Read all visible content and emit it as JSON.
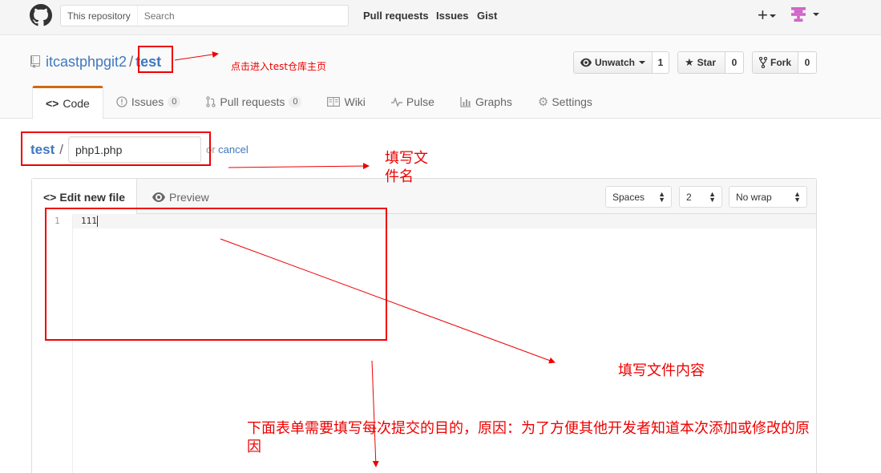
{
  "header": {
    "search_scope": "This repository",
    "search_placeholder": "Search",
    "nav": [
      "Pull requests",
      "Issues",
      "Gist"
    ],
    "plus_icon": "plus-icon",
    "avatar_color": "#d066c8"
  },
  "repo": {
    "owner": "itcastphpgit2",
    "name": "test",
    "separator": "/",
    "unwatch_label": "Unwatch",
    "unwatch_count": "1",
    "star_label": "Star",
    "star_count": "0",
    "fork_label": "Fork",
    "fork_count": "0"
  },
  "tabs": {
    "code": "Code",
    "issues": "Issues",
    "issues_count": "0",
    "pulls": "Pull requests",
    "pulls_count": "0",
    "wiki": "Wiki",
    "pulse": "Pulse",
    "graphs": "Graphs",
    "settings": "Settings"
  },
  "edit": {
    "repo_link": "test",
    "separator": "/",
    "filename": "php1.php",
    "or_text": "or",
    "cancel": "cancel"
  },
  "editor": {
    "edit_tab": "Edit new file",
    "preview_tab": "Preview",
    "indent_mode": "Spaces",
    "indent_size": "2",
    "wrap_mode": "No wrap",
    "line_number": "1",
    "line_content": "111"
  },
  "annotations": {
    "repo_home": "点击进入test仓库主页",
    "filename_note_1": "填写文",
    "filename_note_2": "件名",
    "content_note": "填写文件内容",
    "commit_note_1": "下面表单需要填写每次提交的目的，原因：为了方便其他开发者知道本次添加或修改的原",
    "commit_note_2": "因",
    "color": "#e00000"
  },
  "colors": {
    "link": "#4078c0",
    "active_tab_accent": "#d26911"
  }
}
